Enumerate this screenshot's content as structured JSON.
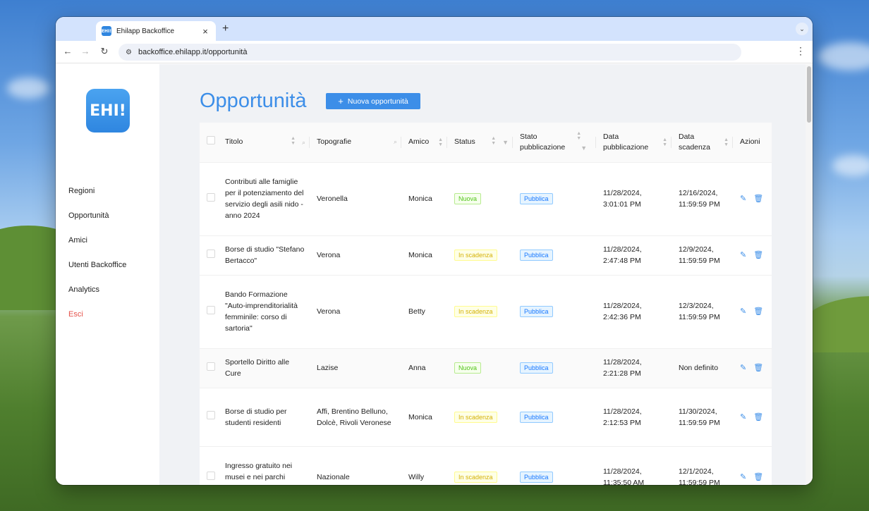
{
  "browser": {
    "tab_title": "Ehilapp Backoffice",
    "favicon_text": "EHI!",
    "close_tab": "×",
    "new_tab": "+",
    "url": "backoffice.ehilapp.it/opportunità"
  },
  "sidebar": {
    "logo_text": "EHI!",
    "items": [
      "Regioni",
      "Opportunità",
      "Amici",
      "Utenti Backoffice",
      "Analytics",
      "Esci"
    ]
  },
  "main": {
    "title": "Opportunità",
    "new_button": "Nuova opportunità"
  },
  "table": {
    "headers": {
      "titolo": "Titolo",
      "topografie": "Topografie",
      "amico": "Amico",
      "status": "Status",
      "stato_pubblicazione": "Stato pubblicazione",
      "data_pubblicazione": "Data pubblicazione",
      "data_scadenza": "Data scadenza",
      "azioni": "Azioni"
    },
    "rows": [
      {
        "titolo": "Contributi alle famiglie per il potenziamento del servizio degli asili nido - anno 2024",
        "topografie": "Veronella",
        "amico": "Monica",
        "status": "Nuova",
        "stato": "Pubblica",
        "data_pub": "11/28/2024, 3:01:01 PM",
        "data_scad": "12/16/2024, 11:59:59 PM"
      },
      {
        "titolo": "Borse di studio \"Stefano Bertacco\"",
        "topografie": "Verona",
        "amico": "Monica",
        "status": "In scadenza",
        "stato": "Pubblica",
        "data_pub": "11/28/2024, 2:47:48 PM",
        "data_scad": "12/9/2024, 11:59:59 PM"
      },
      {
        "titolo": "Bando Formazione \"Auto-imprenditorialità femminile: corso di sartoria\"",
        "topografie": "Verona",
        "amico": "Betty",
        "status": "In scadenza",
        "stato": "Pubblica",
        "data_pub": "11/28/2024, 2:42:36 PM",
        "data_scad": "12/3/2024, 11:59:59 PM"
      },
      {
        "titolo": "Sportello Diritto alle Cure",
        "topografie": "Lazise",
        "amico": "Anna",
        "status": "Nuova",
        "stato": "Pubblica",
        "data_pub": "11/28/2024, 2:21:28 PM",
        "data_scad": "Non definito"
      },
      {
        "titolo": "Borse di studio per studenti residenti",
        "topografie": "Affi, Brentino Belluno, Dolcè, Rivoli Veronese",
        "amico": "Monica",
        "status": "In scadenza",
        "stato": "Pubblica",
        "data_pub": "11/28/2024, 2:12:53 PM",
        "data_scad": "11/30/2024, 11:59:59 PM"
      },
      {
        "titolo": "Ingresso gratuito nei musei e nei parchi archeologici statali",
        "topografie": "Nazionale",
        "amico": "Willy",
        "status": "In scadenza",
        "stato": "Pubblica",
        "data_pub": "11/28/2024, 11:35:50 AM",
        "data_scad": "12/1/2024, 11:59:59 PM"
      }
    ]
  },
  "colors": {
    "accent": "#3c8ee8",
    "exit": "#e5534b"
  }
}
